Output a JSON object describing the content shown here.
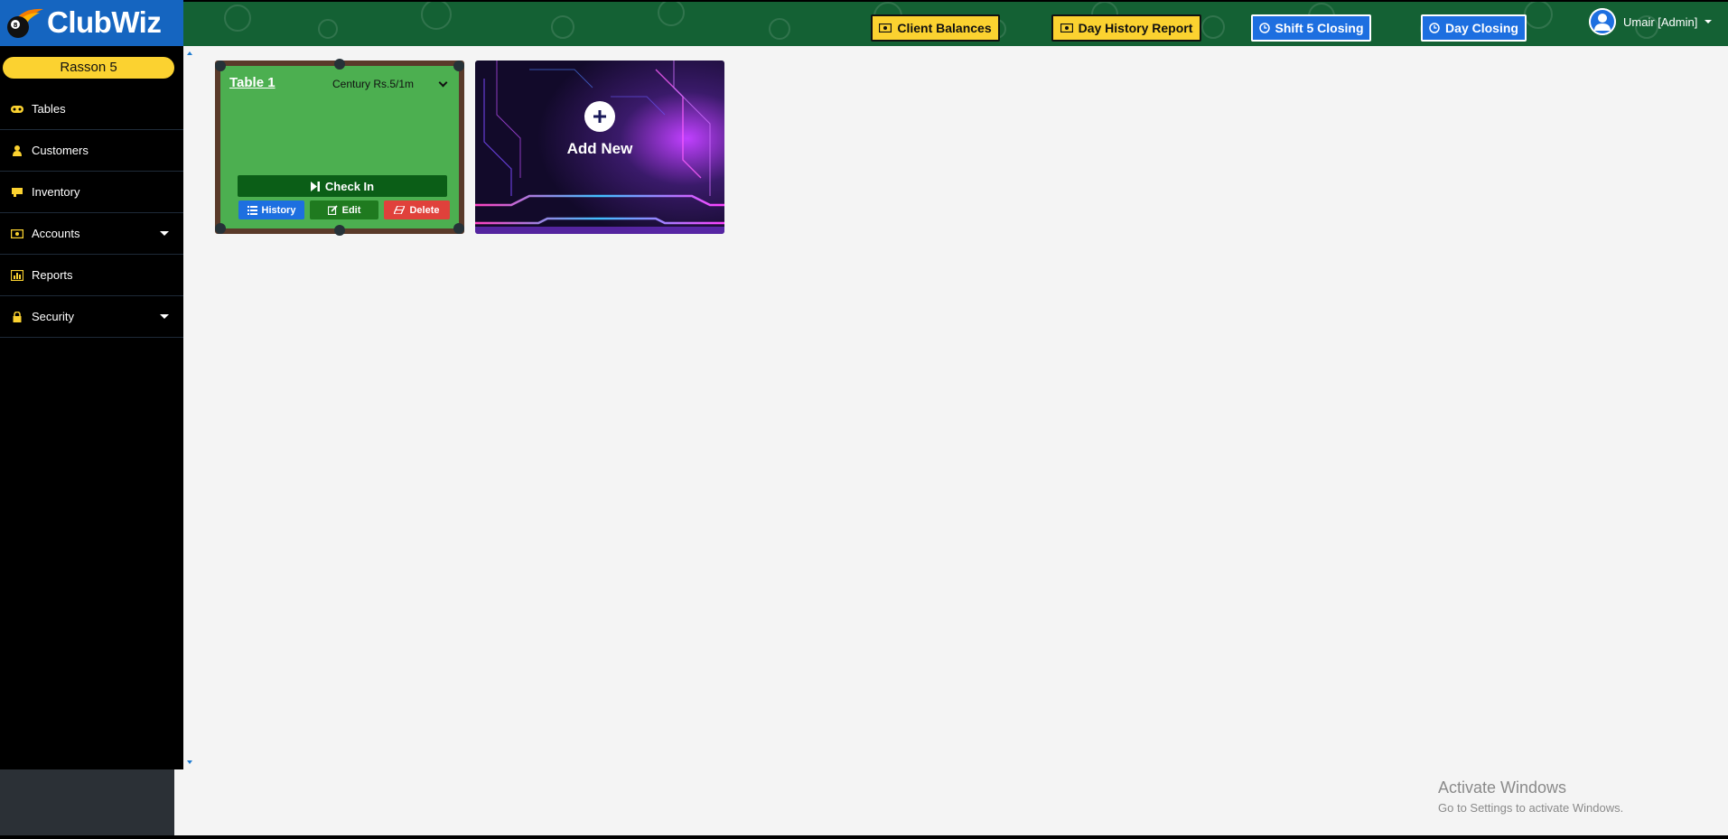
{
  "app": {
    "name": "ClubWiz"
  },
  "sidebar": {
    "branch": "Rasson 5",
    "items": [
      {
        "label": "Tables",
        "icon": "gamepad-icon",
        "has_caret": false
      },
      {
        "label": "Customers",
        "icon": "user-icon",
        "has_caret": false
      },
      {
        "label": "Inventory",
        "icon": "inventory-icon",
        "has_caret": false
      },
      {
        "label": "Accounts",
        "icon": "money-icon",
        "has_caret": true
      },
      {
        "label": "Reports",
        "icon": "chart-icon",
        "has_caret": false
      },
      {
        "label": "Security",
        "icon": "lock-icon",
        "has_caret": true
      }
    ]
  },
  "topbar": {
    "client_balances": "Client Balances",
    "day_history_report": "Day History Report",
    "shift_closing": "Shift 5 Closing",
    "day_closing": "Day Closing",
    "user": "Umair [Admin]"
  },
  "tables": [
    {
      "name": "Table 1",
      "rate": "Century Rs.5/1m",
      "checkin_label": "Check In",
      "history_label": "History",
      "edit_label": "Edit",
      "delete_label": "Delete"
    }
  ],
  "add_new": {
    "label": "Add New"
  },
  "watermark": {
    "line1": "Activate Windows",
    "line2": "Go to Settings to activate Windows."
  },
  "colors": {
    "topbar": "#146134",
    "logo_bg": "#1565c0",
    "accent_yellow": "#fbd230",
    "accent_blue": "#1d6fe0",
    "table_felt": "#4caf50",
    "delete_red": "#e0413b"
  }
}
